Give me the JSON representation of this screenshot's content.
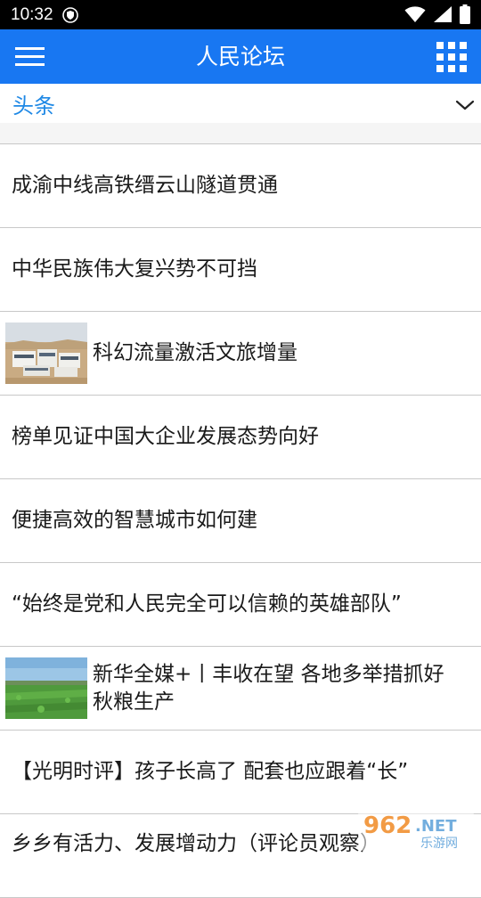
{
  "status_bar": {
    "time": "10:32"
  },
  "header": {
    "title": "人民论坛"
  },
  "tab_bar": {
    "label": "头条"
  },
  "news": [
    {
      "title": "成渝中线高铁缙云山隧道贯通",
      "thumbnail": null
    },
    {
      "title": "中华民族伟大复兴势不可挡",
      "thumbnail": null
    },
    {
      "title": "科幻流量激活文旅增量",
      "thumbnail": "desert-buildings"
    },
    {
      "title": "榜单见证中国大企业发展态势向好",
      "thumbnail": null
    },
    {
      "title": "便捷高效的智慧城市如何建",
      "thumbnail": null
    },
    {
      "title": "“始终是党和人民完全可以信赖的英雄部队”",
      "thumbnail": null
    },
    {
      "title": "新华全媒+丨丰收在望 各地多举措抓好秋粮生产",
      "thumbnail": "green-field"
    },
    {
      "title": "【光明时评】孩子长高了 配套也应跟着“长”",
      "thumbnail": null
    },
    {
      "title": "乡乡有活力、发展增动力（评论员观察）",
      "thumbnail": null
    }
  ],
  "watermark": {
    "number": "962",
    "suffix": ".NET",
    "label": "乐游网"
  },
  "colors": {
    "app_bar": "#1877f2",
    "tab_label": "#1e88e5",
    "status_bar": "#000000",
    "divider": "#c8c8c8"
  }
}
